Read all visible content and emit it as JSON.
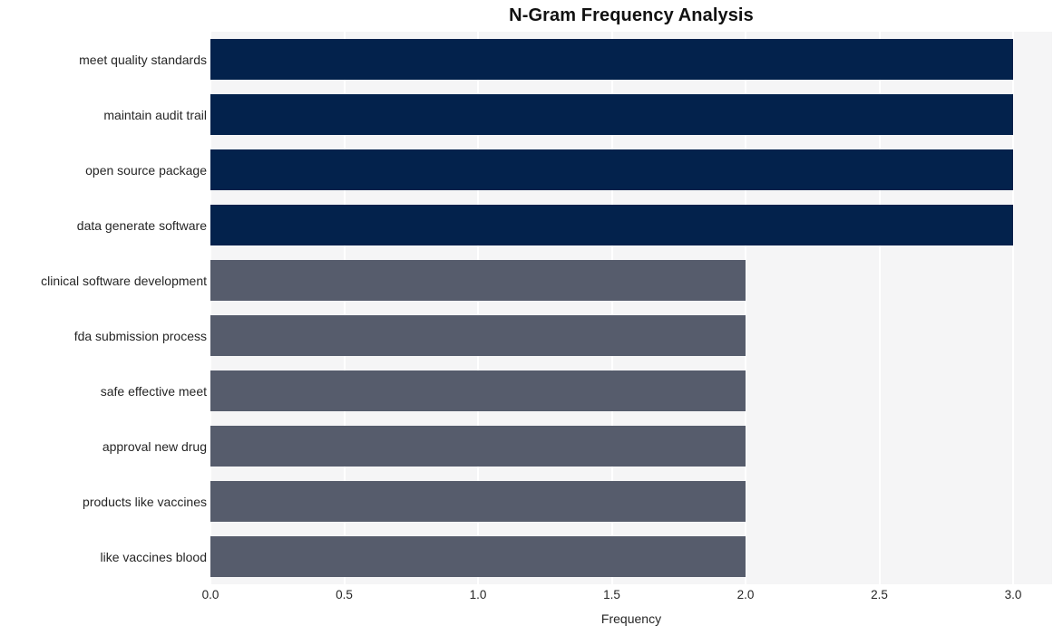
{
  "chart_data": {
    "type": "bar",
    "orientation": "horizontal",
    "title": "N-Gram Frequency Analysis",
    "xlabel": "Frequency",
    "ylabel": "",
    "xlim": [
      0.0,
      3.0
    ],
    "xticks": [
      "0.0",
      "0.5",
      "1.0",
      "1.5",
      "2.0",
      "2.5",
      "3.0"
    ],
    "xtick_values": [
      0.0,
      0.5,
      1.0,
      1.5,
      2.0,
      2.5,
      3.0
    ],
    "grid": true,
    "grid_axis": "x",
    "legend": null,
    "categories": [
      "meet quality standards",
      "maintain audit trail",
      "open source package",
      "data generate software",
      "clinical software development",
      "fda submission process",
      "safe effective meet",
      "approval new drug",
      "products like vaccines",
      "like vaccines blood"
    ],
    "values": [
      3,
      3,
      3,
      3,
      2,
      2,
      2,
      2,
      2,
      2
    ],
    "bar_colors": [
      "#03224c",
      "#03224c",
      "#03224c",
      "#03224c",
      "#565c6c",
      "#565c6c",
      "#565c6c",
      "#565c6c",
      "#565c6c",
      "#565c6c"
    ]
  },
  "style": {
    "plot_background": "#f5f5f6",
    "figure_background": "#ffffff",
    "gridline_color": "#ffffff",
    "text_color": "#262626",
    "title_color": "#111111"
  }
}
